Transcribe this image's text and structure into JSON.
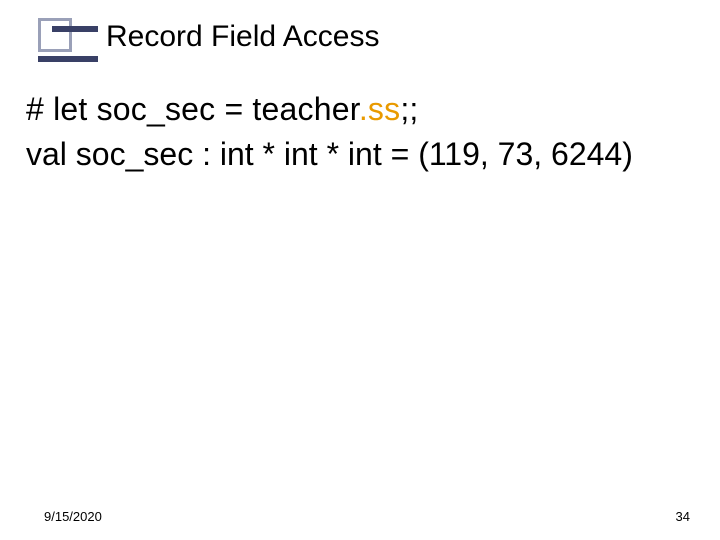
{
  "title": "Record Field Access",
  "code": {
    "line1_pre": "# let soc_sec = teacher",
    "line1_hl": ".ss",
    "line1_post": ";;",
    "line2": "val soc_sec : int * int * int = (119, 73, 6244)"
  },
  "footer": {
    "date": "9/15/2020",
    "page": "34"
  }
}
